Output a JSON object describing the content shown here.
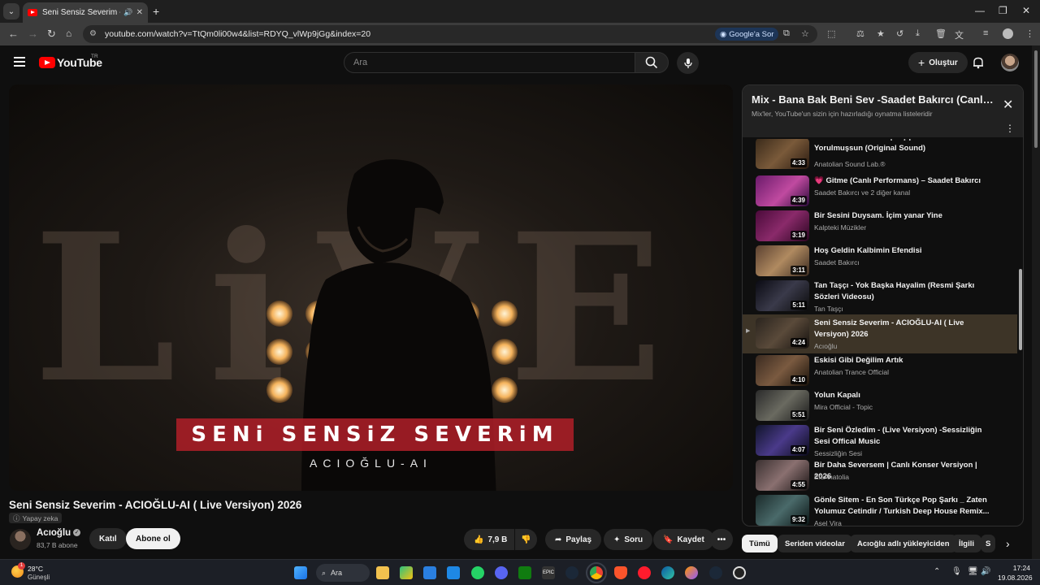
{
  "browser": {
    "tab_title": "Seni Sensiz Severim - ACIO",
    "url": "youtube.com/watch?v=TtQm0li00w4&list=RDYQ_vlWp9jGg&index=20",
    "google_ask": "Google'a Sor"
  },
  "header": {
    "logo_text": "YouTube",
    "region": "TR",
    "search_placeholder": "Ara",
    "create_label": "Oluştur"
  },
  "video": {
    "overlay_title": "SENi SENSiZ SEVERiM",
    "overlay_artist": "ACIOĞLU-AI",
    "title": "Seni Sensiz Severim - ACIOĞLU-AI ( Live Versiyon) 2026",
    "ai_badge": "Yapay zeka",
    "channel": "Acıoğlu",
    "subscribers": "83,7 B abone",
    "join_label": "Katıl",
    "subscribe_label": "Abone ol",
    "likes": "7,9 B",
    "share_label": "Paylaş",
    "ask_label": "Soru",
    "save_label": "Kaydet"
  },
  "playlist": {
    "title": "Mix - Bana Bak Beni Sev -Saadet Bakırcı (Canlı Performans)",
    "subtitle": "Mix'ler, YouTube'un sizin için hazırladığı oynatma listeleridir",
    "items": [
      {
        "title": "Gördün mü Yıllar Geçmiş | Bak Sende Yorulmuşsun (Original Sound)",
        "channel": "Anatolian Sound Lab.®",
        "duration": "4:33"
      },
      {
        "title": "💗 Gitme (Canlı Performans) – Saadet Bakırcı",
        "channel": "Saadet Bakırcı ve 2 diğer kanal",
        "duration": "4:39"
      },
      {
        "title": "Bir Sesini Duysam. İçim yanar Yine",
        "channel": "Kalpteki Müzikler",
        "duration": "3:19"
      },
      {
        "title": "Hoş Geldin Kalbimin Efendisi",
        "channel": "Saadet Bakırcı",
        "duration": "3:11"
      },
      {
        "title": "Tan Taşçı - Yok Başka Hayalim (Resmi Şarkı Sözleri Videosu)",
        "channel": "Tan Taşçı",
        "duration": "5:11"
      },
      {
        "title": "Seni Sensiz Severim - ACIOĞLU-AI ( Live Versiyon) 2026",
        "channel": "Acıoğlu",
        "duration": "4:24"
      },
      {
        "title": "Eskisi Gibi Değilim Artık",
        "channel": "Anatolian Trance Official",
        "duration": "4:10"
      },
      {
        "title": "Yolun Kapalı",
        "channel": "Mira Official - Topic",
        "duration": "5:51"
      },
      {
        "title": "Bir Seni Özledim - (Live Versiyon) -Sessizliğin Sesi Offical Music",
        "channel": "Sessizliğin Sesi",
        "duration": "4:07"
      },
      {
        "title": "Bir Daha Seversem | Canlı Konser Versiyon | 2026",
        "channel": "EfsAnatolia",
        "duration": "4:55"
      },
      {
        "title": "Gönle Sitem - En Son Türkçe Pop Şarkı _ Zaten Yolumuz Cetindir / Turkish Deep House Remix...",
        "channel": "Asel Vira",
        "duration": "9:32"
      }
    ]
  },
  "chips": [
    "Tümü",
    "Seriden videolar",
    "Acıoğlu adlı yükleyiciden",
    "İlgili",
    "S"
  ],
  "taskbar": {
    "temp": "28°C",
    "weather": "Güneşli",
    "search_label": "Ara",
    "time": "17:24",
    "date": "19.08.2026"
  }
}
